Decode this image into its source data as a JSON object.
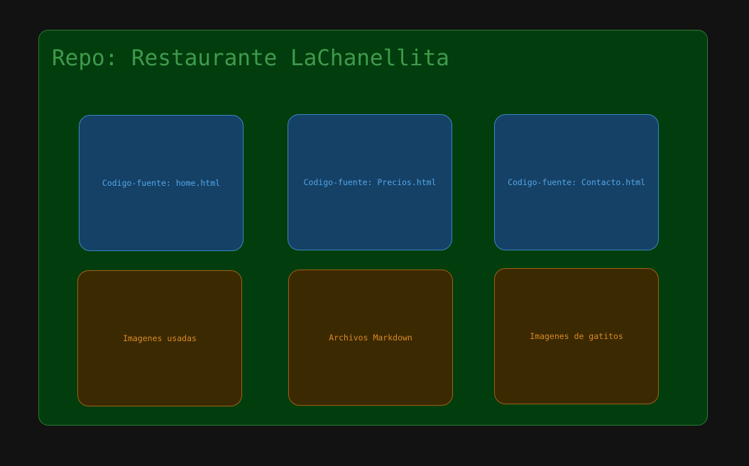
{
  "diagram": {
    "title": "Repo: Restaurante LaChanellita",
    "colors": {
      "background": "#121212",
      "repo_fill": "#023d0d",
      "repo_stroke": "#2b7a35",
      "title_text": "#3e9a4b",
      "source_fill": "#154166",
      "source_stroke": "#3a86c4",
      "source_text": "#52a6e8",
      "asset_fill": "#3b2902",
      "asset_stroke": "#a06014",
      "asset_text": "#d88a26"
    },
    "source_files": [
      {
        "label": "Codigo-fuente: home.html"
      },
      {
        "label": "Codigo-fuente: Precios.html"
      },
      {
        "label": "Codigo-fuente: Contacto.html"
      }
    ],
    "asset_groups": [
      {
        "label": "Imagenes usadas"
      },
      {
        "label": "Archivos Markdown"
      },
      {
        "label": "Imagenes de gatitos"
      }
    ]
  }
}
